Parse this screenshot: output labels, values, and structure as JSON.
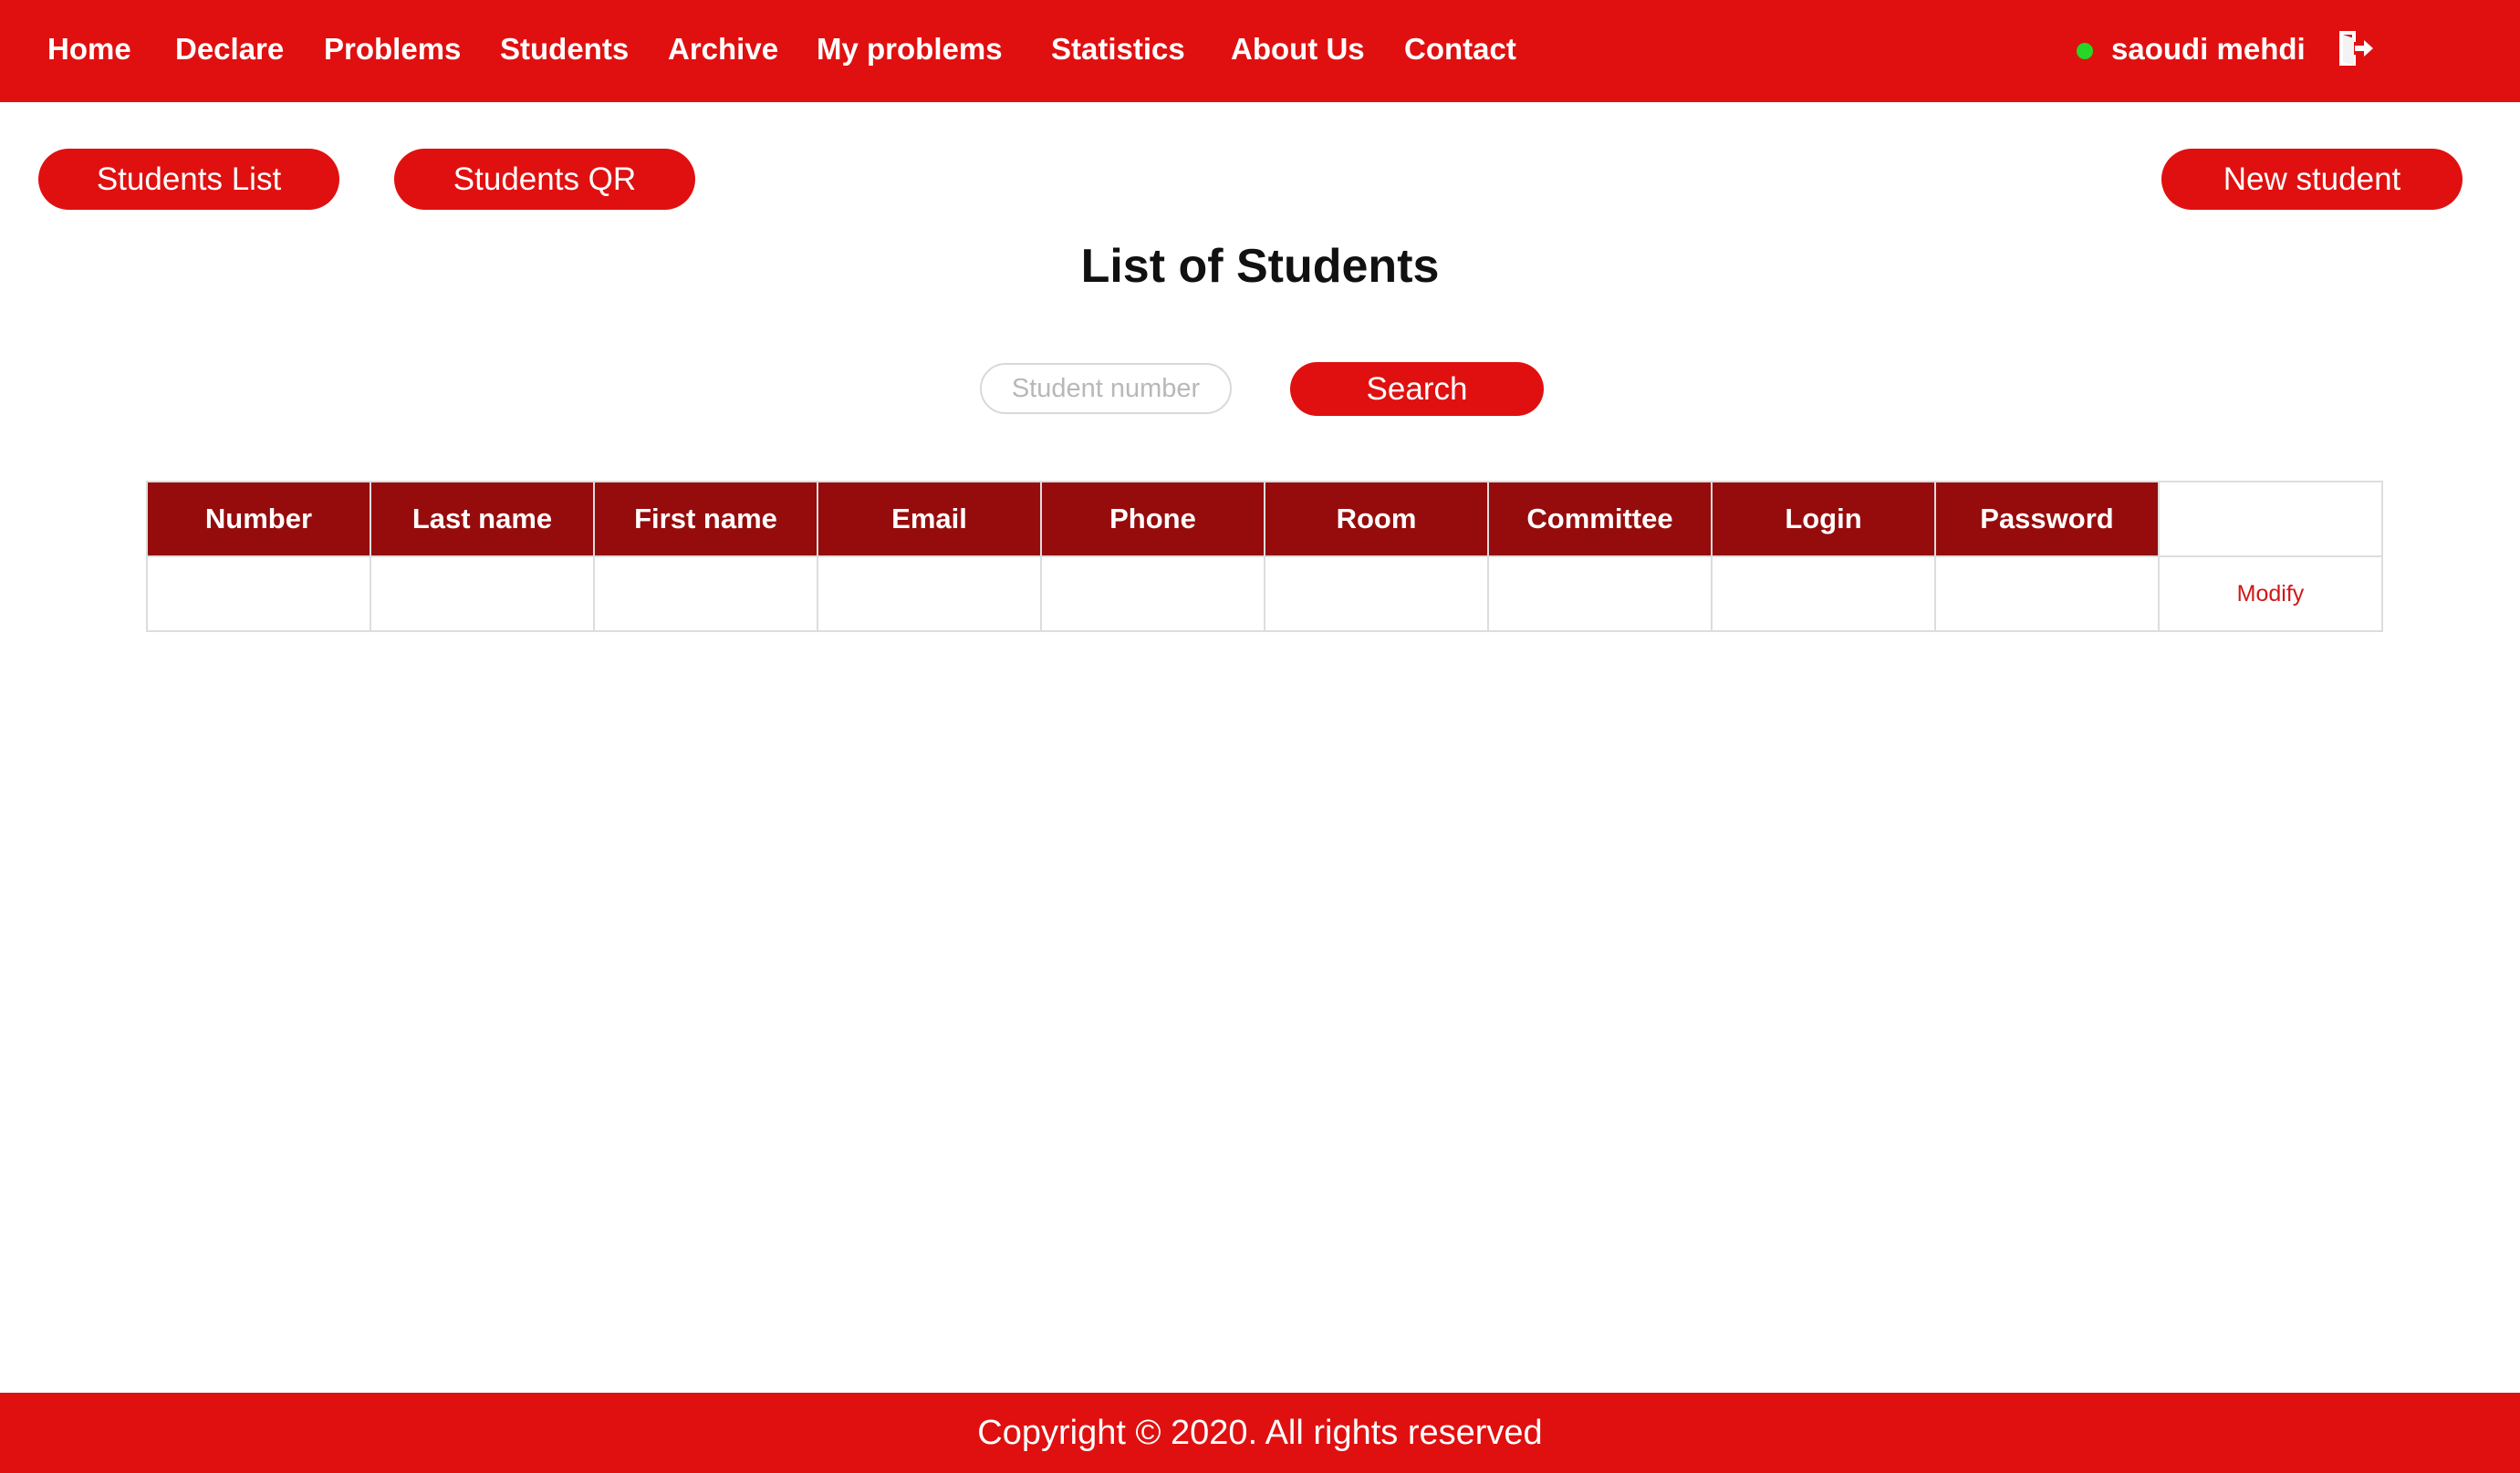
{
  "nav": {
    "items": [
      {
        "label": "Home"
      },
      {
        "label": "Declare"
      },
      {
        "label": "Problems"
      },
      {
        "label": "Students"
      },
      {
        "label": "Archive"
      },
      {
        "label": "My problems"
      },
      {
        "label": "Statistics"
      },
      {
        "label": "About Us"
      },
      {
        "label": "Contact"
      }
    ],
    "user_name": "saoudi mehdi",
    "status_color": "#27d627"
  },
  "actions": {
    "students_list": "Students List",
    "students_qr": "Students QR",
    "new_student": "New student"
  },
  "page_title": "List of Students",
  "search": {
    "placeholder": "Student number",
    "value": "",
    "button_label": "Search"
  },
  "table": {
    "headers": [
      "Number",
      "Last name",
      "First name",
      "Email",
      "Phone",
      "Room",
      "Committee",
      "Login",
      "Password"
    ],
    "rows": [
      {
        "cells": [
          "",
          "",
          "",
          "",
          "",
          "",
          "",
          "",
          ""
        ],
        "action": "Modify"
      }
    ]
  },
  "footer": {
    "text": "Copyright © 2020. All rights reserved"
  },
  "colors": {
    "brand_red": "#e01010",
    "table_header": "#960c0c",
    "link_red": "#d01818"
  },
  "icons": {
    "logout": "logout-icon"
  }
}
